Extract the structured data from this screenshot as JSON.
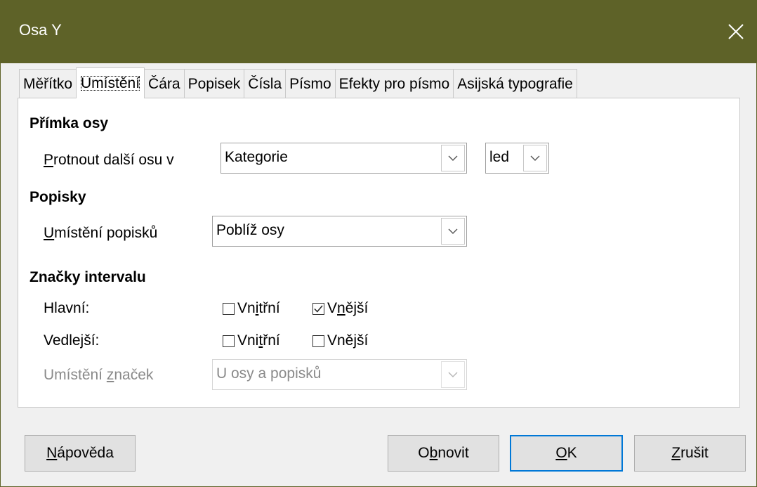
{
  "window": {
    "title": "Osa Y"
  },
  "tabs": [
    {
      "label": "Měřítko"
    },
    {
      "label": "Umístění"
    },
    {
      "label": "Čára"
    },
    {
      "label": "Popisek"
    },
    {
      "label": "Čísla"
    },
    {
      "label": "Písmo"
    },
    {
      "label": "Efekty pro písmo"
    },
    {
      "label": "Asijská typografie"
    }
  ],
  "axis_line": {
    "title": "Přímka osy",
    "cross_label_first": "P",
    "cross_label_rest": "rotnout další osu v",
    "cross_value": "Kategorie",
    "cross_sub_value": "led"
  },
  "labels": {
    "title": "Popisky",
    "placement_label_first": "U",
    "placement_label_rest": "místění popisků",
    "placement_value": "Poblíž osy"
  },
  "interval_marks": {
    "title": "Značky intervalu",
    "major_label": "Hlavní:",
    "minor_label": "Vedlejší:",
    "inner": {
      "a": "Vn",
      "b": "i",
      "c": "třní"
    },
    "inner2": {
      "a": "Vni",
      "b": "t",
      "c": "řní"
    },
    "outer": {
      "a": "V",
      "b": "n",
      "c": "ější"
    },
    "outer_plain": "Vnější",
    "major_inner_checked": false,
    "major_outer_checked": true,
    "minor_inner_checked": false,
    "minor_outer_checked": false,
    "placement_label_a": "Umístění ",
    "placement_label_b": "z",
    "placement_label_c": "naček",
    "placement_value": "U osy a popisků"
  },
  "buttons": {
    "help_first": "N",
    "help_rest": "ápověda",
    "reset_a": "O",
    "reset_b": "b",
    "reset_c": "novit",
    "ok_first": "O",
    "ok_rest": "K",
    "cancel_first": "Z",
    "cancel_rest": "rušit"
  },
  "colors": {
    "titlebar": "#5e6228",
    "accent": "#0078d7"
  }
}
